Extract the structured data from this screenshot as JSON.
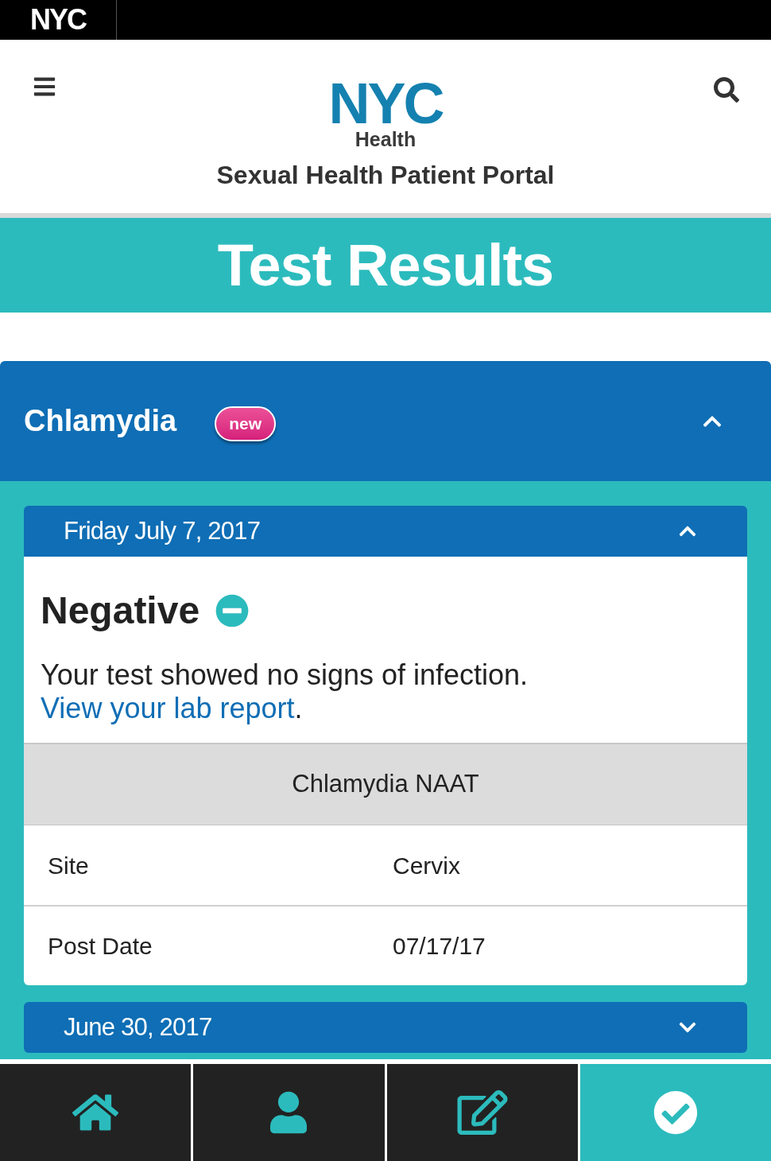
{
  "top_bar": {
    "logo": "NYC"
  },
  "header": {
    "logo_wordmark": "NYC",
    "logo_subtitle": "Health",
    "portal_title": "Sexual Health Patient Portal"
  },
  "page_title": "Test Results",
  "tests": [
    {
      "name": "Chlamydia",
      "badge": "new",
      "expanded": true,
      "visits": [
        {
          "date": "Friday July 7, 2017",
          "expanded": true,
          "result": {
            "kind": "negative",
            "label": "Negative"
          },
          "message": "Your test showed no signs of infection.",
          "link": "View your lab report",
          "message_end": ".",
          "assay": "Chlamydia NAAT",
          "details": [
            {
              "label": "Site",
              "value": "Cervix"
            },
            {
              "label": "Post Date",
              "value": "07/17/17"
            }
          ]
        },
        {
          "date": "June 30, 2017",
          "expanded": false
        }
      ]
    }
  ],
  "bottom_nav": [
    {
      "kind": "home",
      "selected": false
    },
    {
      "kind": "profile",
      "selected": false
    },
    {
      "kind": "edit",
      "selected": false
    },
    {
      "kind": "results",
      "selected": true
    }
  ]
}
